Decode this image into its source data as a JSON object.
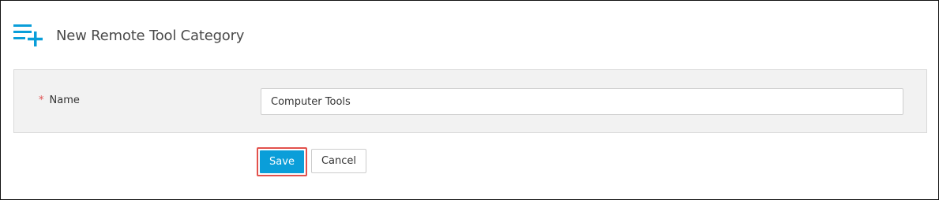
{
  "header": {
    "icon": "list-add-icon",
    "title": "New Remote Tool Category"
  },
  "form": {
    "fields": [
      {
        "required_marker": "*",
        "label": "Name",
        "value": "Computer Tools"
      }
    ]
  },
  "actions": {
    "save_label": "Save",
    "cancel_label": "Cancel"
  },
  "colors": {
    "accent": "#0a9ed9",
    "highlight_outline": "#e2514c",
    "required": "#e05252",
    "panel_background": "#f2f2f2"
  }
}
